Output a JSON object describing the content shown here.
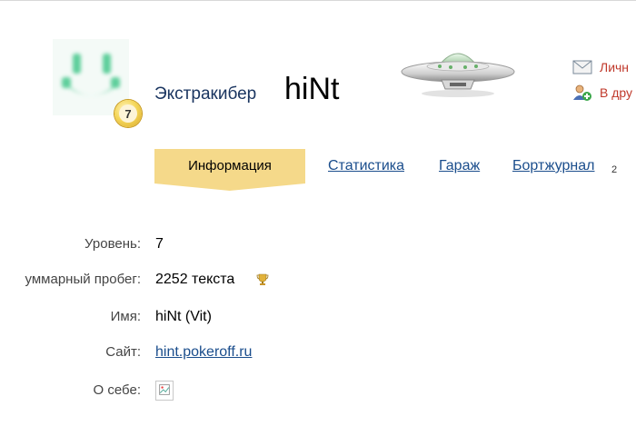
{
  "profile": {
    "rank": "Экстракибер",
    "nickname": "hiNt",
    "level_badge": "7"
  },
  "actions": {
    "mail": "Личн",
    "add_friend": "В дру"
  },
  "tabs": {
    "info": "Информация",
    "stats": "Статистика",
    "garage": "Гараж",
    "journal": "Бортжурнал",
    "journal_count": "2"
  },
  "details": {
    "level_label": "Уровень:",
    "level_value": "7",
    "mileage_label": "уммарный пробег:",
    "mileage_value": "2252 текста",
    "name_label": "Имя:",
    "name_value": "hiNt (Vit)",
    "site_label": "Сайт:",
    "site_value": "hint.pokeroff.ru",
    "about_label": "О себе:"
  },
  "colors": {
    "rank_text": "#1a3560",
    "link": "#1a4d8c",
    "action_link": "#c0392b",
    "active_tab": "#f5d98a",
    "avatar_smile": "#5fcf9b"
  },
  "icons": {
    "mail": "envelope-icon",
    "add_friend": "user-add-icon",
    "mileage": "trophy-icon",
    "about": "broken-image-icon",
    "header_art": "ufo-icon"
  }
}
